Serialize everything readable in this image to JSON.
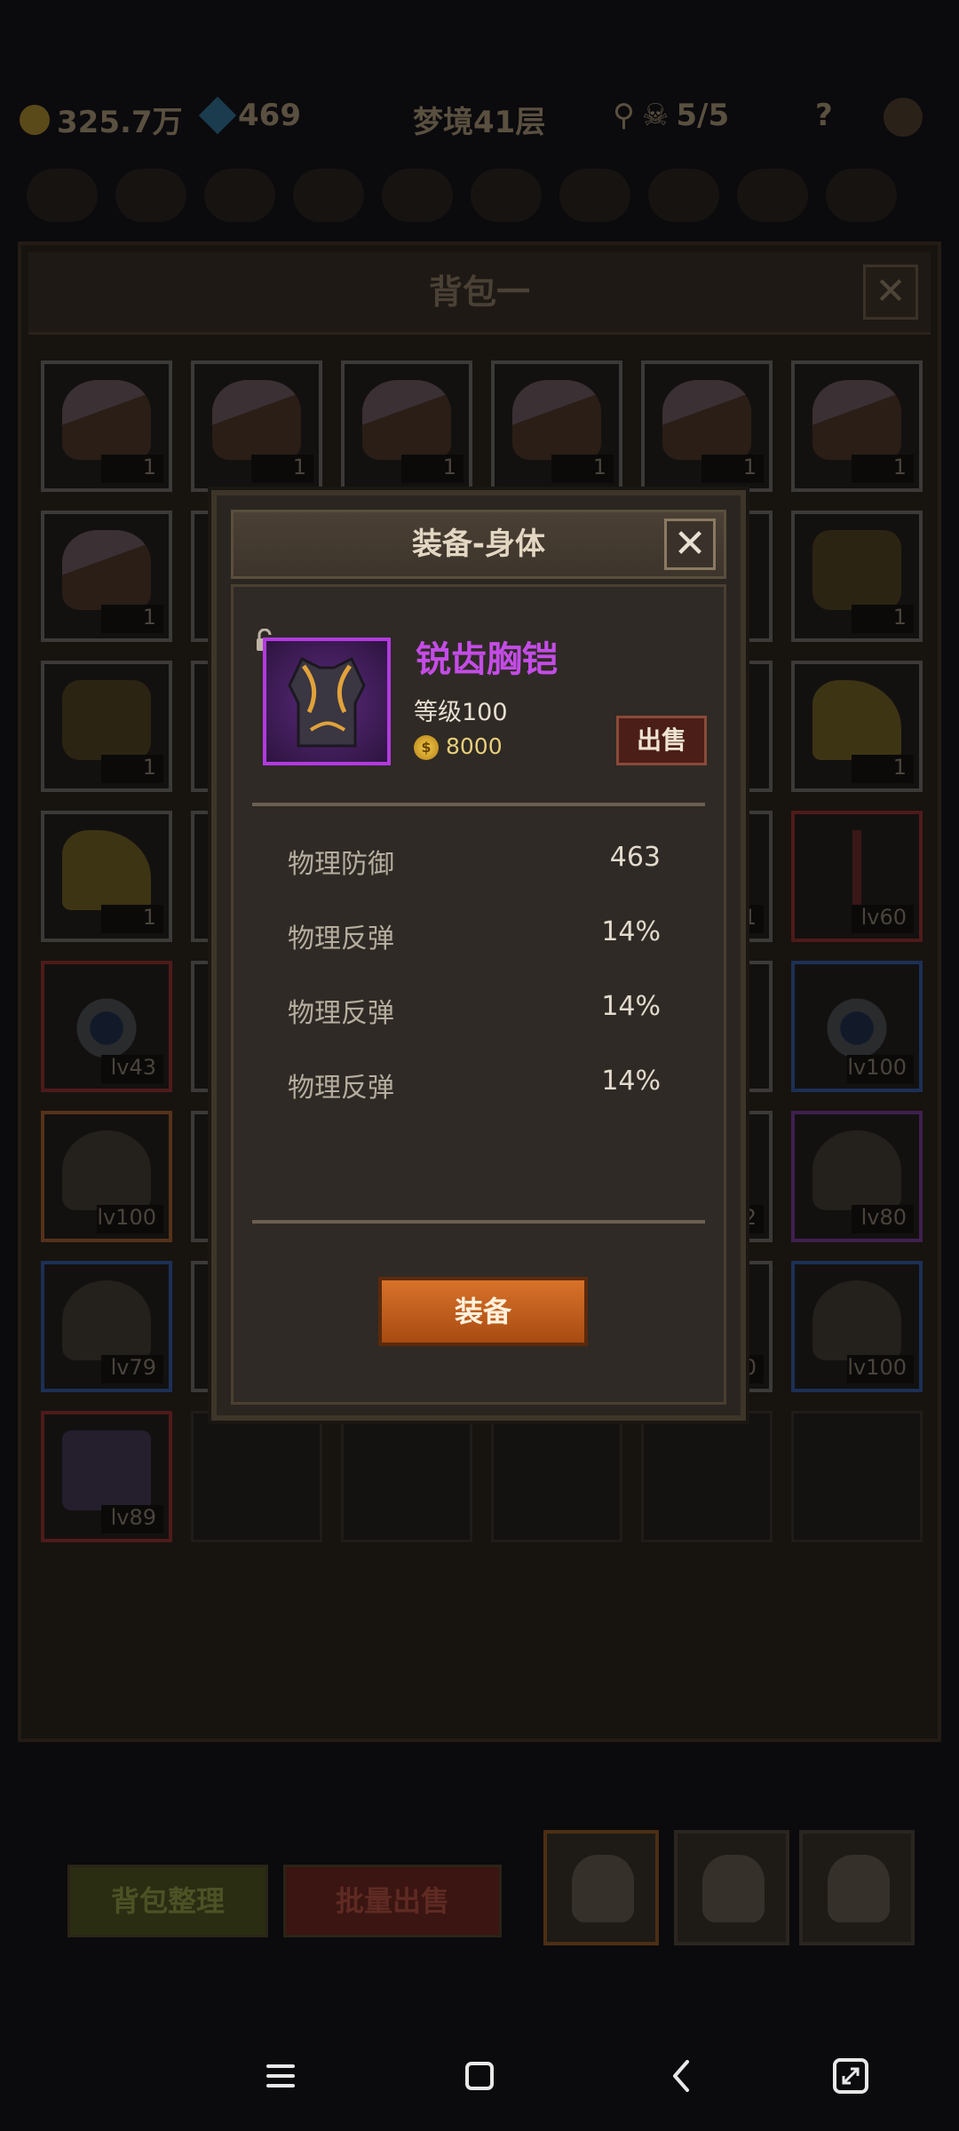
{
  "hud": {
    "gold": "325.7万",
    "gems": "469",
    "stage": "梦境41层",
    "keys": "5/5",
    "help": "?"
  },
  "backpack": {
    "title": "背包一",
    "close": "✕",
    "slots": [
      {
        "art": "cake",
        "label": "1"
      },
      {
        "art": "cake",
        "label": "1"
      },
      {
        "art": "cake",
        "label": "1"
      },
      {
        "art": "cake",
        "label": "1"
      },
      {
        "art": "cake",
        "label": "1"
      },
      {
        "art": "cake",
        "label": "1"
      },
      {
        "art": "cake",
        "label": "1"
      },
      {
        "art": "",
        "label": ""
      },
      {
        "art": "",
        "label": ""
      },
      {
        "art": "",
        "label": ""
      },
      {
        "art": "",
        "label": ""
      },
      {
        "art": "beer",
        "label": "1"
      },
      {
        "art": "beer",
        "label": "1"
      },
      {
        "art": "",
        "label": ""
      },
      {
        "art": "",
        "label": ""
      },
      {
        "art": "",
        "label": ""
      },
      {
        "art": "",
        "label": ""
      },
      {
        "art": "cheese",
        "label": "1"
      },
      {
        "art": "cheese",
        "label": "1"
      },
      {
        "art": "",
        "label": ""
      },
      {
        "art": "",
        "label": ""
      },
      {
        "art": "",
        "label": ""
      },
      {
        "art": "",
        "label": "1"
      },
      {
        "art": "trident",
        "label": "lv60"
      },
      {
        "art": "ring",
        "label": "lv43"
      },
      {
        "art": "",
        "label": ""
      },
      {
        "art": "",
        "label": ""
      },
      {
        "art": "",
        "label": ""
      },
      {
        "art": "",
        "label": ""
      },
      {
        "art": "ring",
        "label": "lv100"
      },
      {
        "art": "helm",
        "label": "lv100"
      },
      {
        "art": "",
        "label": ""
      },
      {
        "art": "",
        "label": ""
      },
      {
        "art": "",
        "label": ""
      },
      {
        "art": "",
        "label": "2"
      },
      {
        "art": "helm",
        "label": "lv80"
      },
      {
        "art": "helm",
        "label": "lv79"
      },
      {
        "art": "",
        "label": ""
      },
      {
        "art": "",
        "label": ""
      },
      {
        "art": "",
        "label": ""
      },
      {
        "art": "",
        "label": "00"
      },
      {
        "art": "helm",
        "label": "lv100"
      },
      {
        "art": "gun",
        "label": "lv89"
      },
      {
        "art": "empty",
        "label": ""
      },
      {
        "art": "empty",
        "label": ""
      },
      {
        "art": "empty",
        "label": ""
      },
      {
        "art": "empty",
        "label": ""
      },
      {
        "art": "empty",
        "label": ""
      }
    ],
    "sort_label": "背包整理",
    "batch_sell_label": "批量出售"
  },
  "dialog": {
    "title": "装备-身体",
    "close": "✕",
    "item_name": "锐齿胸铠",
    "item_level": "等级100",
    "price": "8000",
    "coin_symbol": "$",
    "sell_label": "出售",
    "stats": [
      {
        "label": "物理防御",
        "value": "463"
      },
      {
        "label": "物理反弹",
        "value": "14%"
      },
      {
        "label": "物理反弹",
        "value": "14%"
      },
      {
        "label": "物理反弹",
        "value": "14%"
      }
    ],
    "equip_label": "装备",
    "rarity_color": "#b23adf"
  },
  "navbar": {
    "icons": [
      "menu-icon",
      "home-icon",
      "back-icon",
      "screen-rotate-icon"
    ]
  }
}
